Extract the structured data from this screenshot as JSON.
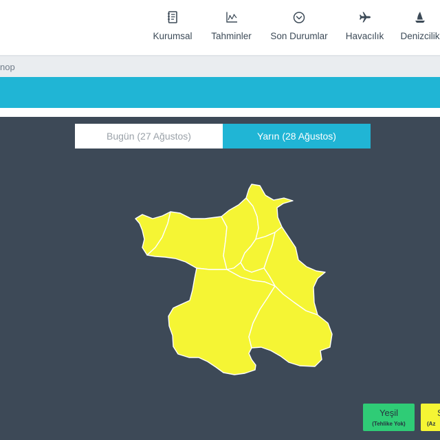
{
  "header": {
    "nav": [
      {
        "label": "Kurumsal",
        "icon": "document-icon"
      },
      {
        "label": "Tahminler",
        "icon": "chart-icon"
      },
      {
        "label": "Son Durumlar",
        "icon": "chevron-circle-icon"
      },
      {
        "label": "Havacılık",
        "icon": "airplane-icon"
      },
      {
        "label": "Denizcilik",
        "icon": "sailboat-icon"
      }
    ]
  },
  "breadcrumb": {
    "text": "nop"
  },
  "tabs": [
    {
      "label": "Bugün (27 Ağustos)",
      "active": false
    },
    {
      "label": "Yarın (28 Ağustos)",
      "active": true
    }
  ],
  "map": {
    "fill_color": "#f5f534",
    "border_color": "#ffffff"
  },
  "legend": [
    {
      "label": "Yeşil",
      "sublabel": "(Tehlike Yok)",
      "color": "#2fcc76"
    },
    {
      "label": "S",
      "sublabel": "(Az",
      "color": "#f5f534"
    }
  ],
  "colors": {
    "accent": "#20b5d5",
    "map_background": "#3d4957",
    "icon": "#3c4a57"
  }
}
